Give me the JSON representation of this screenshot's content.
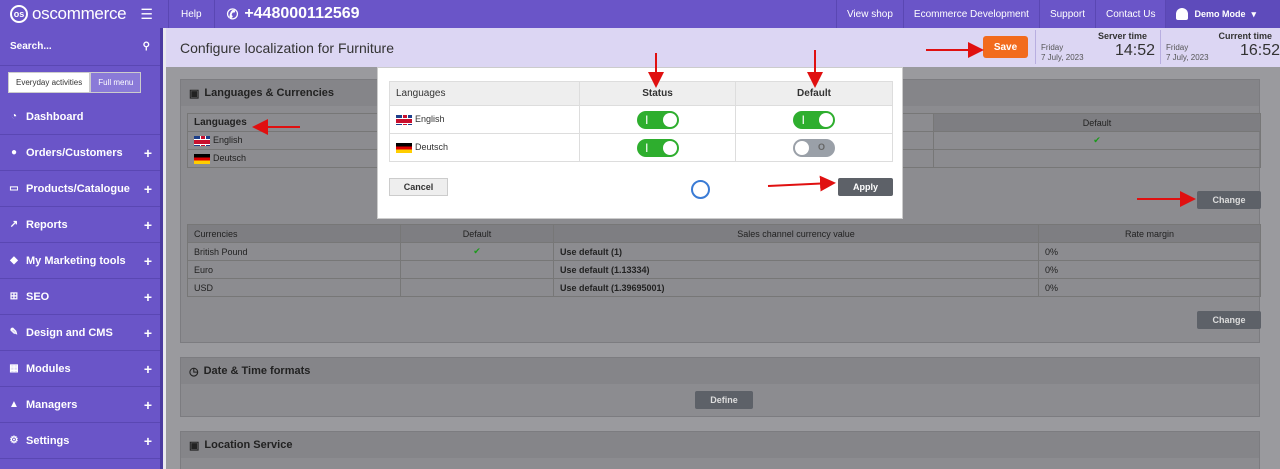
{
  "topbar": {
    "logo_mark": "os",
    "brand": "oscommerce",
    "help": "Help",
    "phone": "+448000112569",
    "nav": [
      "View shop",
      "Ecommerce Development",
      "Support",
      "Contact Us"
    ],
    "demo_mode": "Demo Mode"
  },
  "sidebar": {
    "search_label": "Search...",
    "everyday_label": "Everyday activities",
    "full_menu_label": "Full menu",
    "items": [
      {
        "label": "Dashboard",
        "expandable": false
      },
      {
        "label": "Orders/Customers",
        "expandable": true
      },
      {
        "label": "Products/Catalogue",
        "expandable": true
      },
      {
        "label": "Reports",
        "expandable": true
      },
      {
        "label": "My Marketing tools",
        "expandable": true
      },
      {
        "label": "SEO",
        "expandable": true
      },
      {
        "label": "Design and CMS",
        "expandable": true
      },
      {
        "label": "Modules",
        "expandable": true
      },
      {
        "label": "Managers",
        "expandable": true
      },
      {
        "label": "Settings",
        "expandable": true
      }
    ]
  },
  "header": {
    "title": "Configure localization for Furniture",
    "save_label": "Save",
    "server_time_label": "Server time",
    "server_day": "Friday",
    "server_date": "7 July, 2023",
    "server_clock": "14:52",
    "current_time_label": "Current time",
    "current_day": "Friday",
    "current_date": "7 July, 2023",
    "current_clock": "16:52"
  },
  "languages_panel": {
    "title": "Languages & Currencies",
    "languages_header": "Languages",
    "default_header": "Default",
    "languages": [
      "English",
      "Deutsch"
    ],
    "check": "✔",
    "change_label": "Change"
  },
  "currencies": {
    "headers": [
      "Currencies",
      "Default",
      "Sales channel currency value",
      "Rate margin"
    ],
    "rows": [
      {
        "name": "British Pound",
        "default": "✔",
        "value": "Use default (1)",
        "margin": "0%"
      },
      {
        "name": "Euro",
        "default": "",
        "value": "Use default (1.13334)",
        "margin": "0%"
      },
      {
        "name": "USD",
        "default": "",
        "value": "Use default (1.39695001)",
        "margin": "0%"
      }
    ],
    "change_label": "Change"
  },
  "date_panel": {
    "title": "Date & Time formats",
    "define_label": "Define"
  },
  "location_panel": {
    "title": "Location Service"
  },
  "modal": {
    "headers": [
      "Languages",
      "Status",
      "Default"
    ],
    "rows": [
      {
        "language": "English",
        "status_on": true,
        "default_on": true
      },
      {
        "language": "Deutsch",
        "status_on": true,
        "default_on": false
      }
    ],
    "toggle_on_mark": "|",
    "toggle_off_mark": "O",
    "cancel_label": "Cancel",
    "apply_label": "Apply"
  },
  "colors": {
    "brand_purple": "#6a55c8",
    "save_orange": "#f26b1d",
    "toggle_green": "#2eae2e",
    "annotation_red": "#e01010"
  }
}
